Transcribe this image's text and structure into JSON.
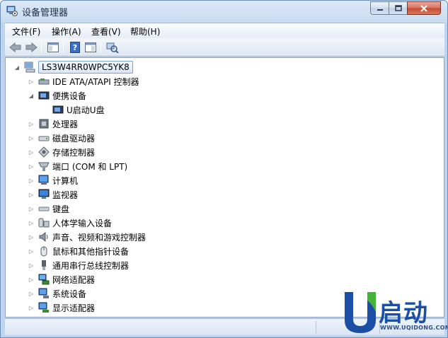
{
  "window": {
    "title": "设备管理器"
  },
  "menu": [
    {
      "label": "文件(F)"
    },
    {
      "label": "操作(A)"
    },
    {
      "label": "查看(V)"
    },
    {
      "label": "帮助(H)"
    }
  ],
  "toolbar": [
    {
      "icon": "back-arrow-icon"
    },
    {
      "icon": "forward-arrow-icon"
    },
    {
      "icon": "console-tree-icon"
    },
    {
      "icon": "help-icon"
    },
    {
      "icon": "properties-icon"
    },
    {
      "icon": "scan-hardware-icon"
    }
  ],
  "tree": {
    "root": {
      "label": "LS3W4RR0WPC5YK8",
      "icon": "computer-icon"
    },
    "items": [
      {
        "label": "IDE ATA/ATAPI 控制器",
        "icon": "ide-controller-icon",
        "expanded": false
      },
      {
        "label": "便携设备",
        "icon": "portable-device-icon",
        "expanded": true
      },
      {
        "label": "U启动U盘",
        "icon": "usb-drive-icon",
        "child": true
      },
      {
        "label": "处理器",
        "icon": "processor-icon",
        "expanded": false
      },
      {
        "label": "磁盘驱动器",
        "icon": "disk-drive-icon",
        "expanded": false
      },
      {
        "label": "存储控制器",
        "icon": "storage-controller-icon",
        "expanded": false
      },
      {
        "label": "端口 (COM 和 LPT)",
        "icon": "port-icon",
        "expanded": false
      },
      {
        "label": "计算机",
        "icon": "computer-monitor-icon",
        "expanded": false
      },
      {
        "label": "监视器",
        "icon": "monitor-icon",
        "expanded": false
      },
      {
        "label": "键盘",
        "icon": "keyboard-icon",
        "expanded": false
      },
      {
        "label": "人体学输入设备",
        "icon": "hid-icon",
        "expanded": false
      },
      {
        "label": "声音、视频和游戏控制器",
        "icon": "speaker-icon",
        "expanded": false
      },
      {
        "label": "鼠标和其他指针设备",
        "icon": "mouse-icon",
        "expanded": false
      },
      {
        "label": "通用串行总线控制器",
        "icon": "usb-icon",
        "expanded": false
      },
      {
        "label": "网络适配器",
        "icon": "network-adapter-icon",
        "expanded": false
      },
      {
        "label": "系统设备",
        "icon": "system-device-icon",
        "expanded": false
      },
      {
        "label": "显示适配器",
        "icon": "display-adapter-icon",
        "expanded": false
      }
    ]
  },
  "watermark": {
    "brand": "U启动",
    "url": "WWW.UQIDONG.COM"
  },
  "colors": {
    "accent": "#1b4fa6",
    "title_bar": "#c9dcf1",
    "selection_border": "#7da2ce"
  }
}
